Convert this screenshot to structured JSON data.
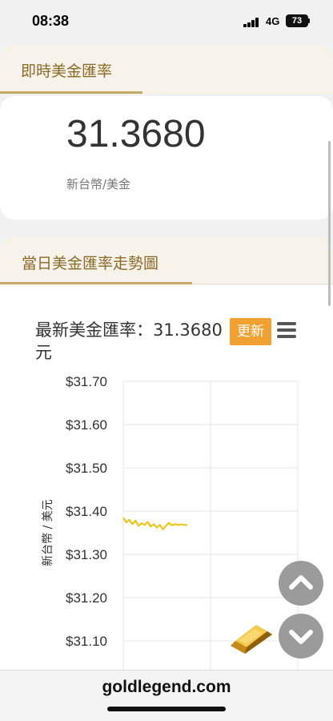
{
  "status_bar": {
    "time": "08:38",
    "network": "4G",
    "battery": "73"
  },
  "rate_section": {
    "tab_label": "即時美金匯率",
    "value": "31.3680",
    "unit": "新台幣/美金"
  },
  "trend_section": {
    "tab_label": "當日美金匯率走勢圖",
    "chart_title": "最新美金匯率：31.3680元",
    "refresh_label": "更新"
  },
  "chart_data": {
    "type": "line",
    "title": "最新美金匯率：31.3680元",
    "ylabel": "新台幣 / 美元",
    "ylim": [
      31.05,
      31.72
    ],
    "y_ticks": [
      31.7,
      31.6,
      31.5,
      31.4,
      31.3,
      31.2,
      31.1
    ],
    "y_tick_labels": [
      "$31.70",
      "$31.60",
      "$31.50",
      "$31.40",
      "$31.30",
      "$31.20",
      "$31.10"
    ],
    "grid": true,
    "colors": {
      "line": "#f0c419",
      "grid": "#e6e6e6",
      "axis_text": "#333333"
    },
    "series": [
      {
        "values": [
          31.385,
          31.374,
          31.38,
          31.37,
          31.378,
          31.366,
          31.372,
          31.368,
          31.375,
          31.364,
          31.37,
          31.362,
          31.368,
          31.358,
          31.366,
          31.373,
          31.367,
          31.37,
          31.368,
          31.369,
          31.368,
          31.368
        ]
      }
    ]
  },
  "footer": {
    "domain": "goldlegend.com"
  },
  "icons": {
    "menu": "hamburger-menu-icon",
    "scroll_up": "chevron-up-icon",
    "scroll_down": "chevron-down-icon",
    "decoration": "gold-bar-icon"
  },
  "colors": {
    "accent_gold": "#c6a869",
    "tab_text": "#8a6a26",
    "button": "#f0a132"
  }
}
